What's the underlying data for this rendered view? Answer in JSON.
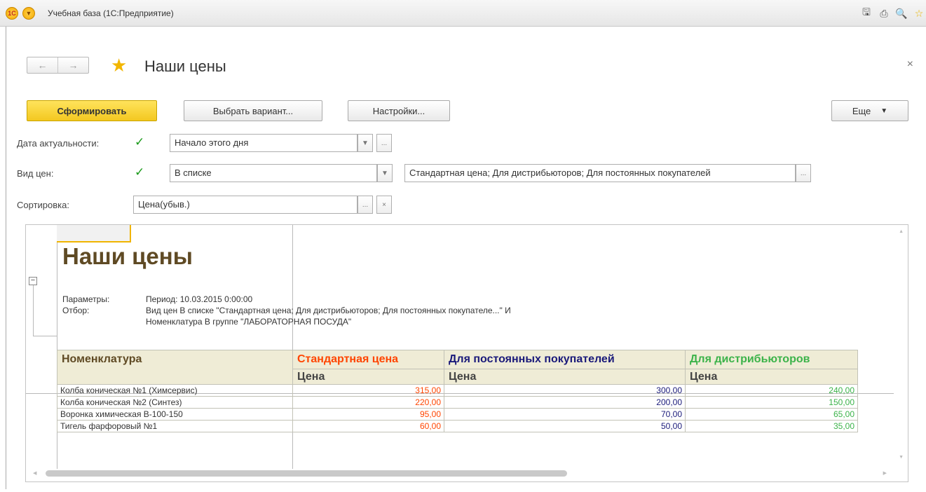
{
  "window": {
    "app_title": "Учебная база (1С:Предприятие)",
    "logo_text": "1С",
    "menu_icon": "chevron-down-icon",
    "toolbar_icons": [
      "save-icon",
      "print-icon",
      "preview-icon",
      "favorite-icon"
    ]
  },
  "header": {
    "back_icon": "←",
    "forward_icon": "→",
    "title": "Наши цены",
    "close_icon": "×"
  },
  "commandbar": {
    "generate": "Сформировать",
    "select_variant": "Выбрать вариант...",
    "settings": "Настройки...",
    "more": "Еще"
  },
  "form": {
    "date_label": "Дата актуальности:",
    "date_value": "Начало этого дня",
    "price_type_label": "Вид цен:",
    "price_type_value": "В списке",
    "price_type_list": "Стандартная цена; Для дистрибьюторов; Для постоянных покупателей",
    "sort_label": "Сортировка:",
    "sort_value": "Цена(убыв.)"
  },
  "report": {
    "title": "Наши цены",
    "params_label": "Параметры:",
    "params_value": "Период: 10.03.2015 0:00:00",
    "filter_label": "Отбор:",
    "filter_line1": "Вид цен В списке \"Стандартная цена; Для дистрибьюторов; Для постоянных покупателе...\" И",
    "filter_line2": "Номенклатура В группе \"ЛАБОРАТОРНАЯ ПОСУДА\"",
    "colors": {
      "standard": "#ff4500",
      "regular": "#1a1a7a",
      "distrib": "#3cb34a",
      "title": "#5f4a24"
    },
    "columns": {
      "nomenclature": "Номенклатура",
      "standard": "Стандартная цена",
      "regular": "Для постоянных покупателей",
      "distrib": "Для дистрибьюторов",
      "price": "Цена"
    },
    "rows": [
      {
        "name": "Колба коническая №1 (Химсервис)",
        "standard": "315,00",
        "regular": "300,00",
        "distrib": "240,00"
      },
      {
        "name": "Колба коническая №2 (Синтез)",
        "standard": "220,00",
        "regular": "200,00",
        "distrib": "150,00"
      },
      {
        "name": "Воронка химическая В-100-150",
        "standard": "95,00",
        "regular": "70,00",
        "distrib": "65,00"
      },
      {
        "name": "Тигель фарфоровый №1",
        "standard": "60,00",
        "regular": "50,00",
        "distrib": "35,00"
      }
    ]
  }
}
